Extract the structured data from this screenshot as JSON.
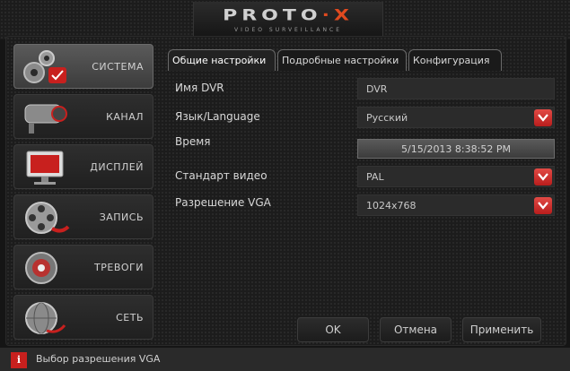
{
  "header": {
    "logo_main": "PROTO",
    "logo_dot": "·",
    "logo_x": "X",
    "logo_sub": "VIDEO SURVEILLANCE"
  },
  "sidebar": {
    "items": [
      {
        "label": "СИСТЕМА",
        "icon": "gears-icon",
        "active": true
      },
      {
        "label": "КАНАЛ",
        "icon": "camera-icon",
        "active": false
      },
      {
        "label": "ДИСПЛЕЙ",
        "icon": "monitor-icon",
        "active": false
      },
      {
        "label": "ЗАПИСЬ",
        "icon": "film-reel-icon",
        "active": false
      },
      {
        "label": "ТРЕВОГИ",
        "icon": "alarm-siren-icon",
        "active": false
      },
      {
        "label": "СЕТЬ",
        "icon": "globe-network-icon",
        "active": false
      }
    ]
  },
  "tabs": [
    {
      "label": "Общие настройки"
    },
    {
      "label": "Подробные настройки"
    },
    {
      "label": "Конфигурация"
    }
  ],
  "form": {
    "dvr_name_label": "Имя DVR",
    "dvr_name_value": "DVR",
    "language_label": "Язык/Language",
    "language_value": "Русский",
    "time_label": "Время",
    "time_value": "5/15/2013 8:38:52 PM",
    "video_std_label": "Стандарт видео",
    "video_std_value": "PAL",
    "vga_label": "Разрешение VGA",
    "vga_value": "1024x768"
  },
  "buttons": {
    "ok": "OK",
    "cancel": "Отмена",
    "apply": "Применить"
  },
  "status": {
    "info_glyph": "i",
    "text": "Выбор разрешения VGA"
  },
  "colors": {
    "accent_red": "#c8201e",
    "logo_orange": "#e04a1f"
  }
}
